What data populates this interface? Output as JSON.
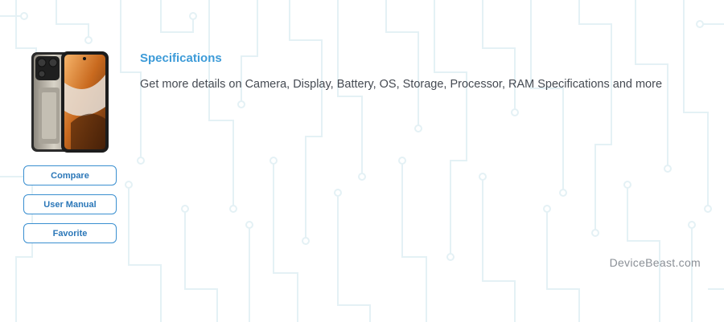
{
  "device": {
    "image_alt": "Rugged smartphone",
    "icon": "phone-image"
  },
  "actions": {
    "compare_label": "Compare",
    "user_manual_label": "User Manual",
    "favorite_label": "Favorite"
  },
  "specs": {
    "title": "Specifications",
    "description": "Get more details on Camera, Display, Battery, OS, Storage, Processor, RAM Specifications and more"
  },
  "branding": {
    "watermark": "DeviceBeast.com"
  },
  "colors": {
    "accent": "#3d9bd8",
    "button_border": "#3a8fd0",
    "text": "#454a52",
    "circuit": "#e6f2f6"
  }
}
